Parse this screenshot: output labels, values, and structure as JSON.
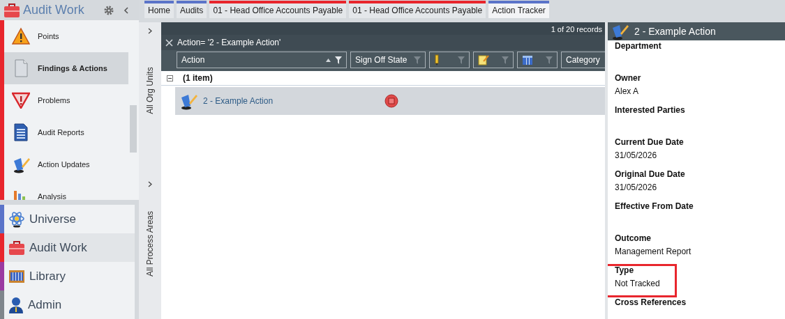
{
  "sidebar": {
    "title": "Audit Work",
    "items": [
      {
        "label": "Points",
        "selected": false
      },
      {
        "label": "Findings & Actions",
        "selected": true
      },
      {
        "label": "Problems",
        "selected": false
      },
      {
        "label": "Audit Reports",
        "selected": false
      },
      {
        "label": "Action Updates",
        "selected": false
      },
      {
        "label": "Analysis",
        "selected": false
      }
    ],
    "modules": [
      {
        "label": "Universe",
        "color": "#5b74c9",
        "selected": false
      },
      {
        "label": "Audit Work",
        "color": "#e8262d",
        "selected": true
      },
      {
        "label": "Library",
        "color": "#9b3aa1",
        "selected": false
      },
      {
        "label": "Admin",
        "color": "#7f868c",
        "selected": false
      }
    ]
  },
  "tabs": [
    {
      "label": "Home",
      "color": "#5b74c9",
      "selected": false
    },
    {
      "label": "Audits",
      "color": "#5b74c9",
      "selected": false
    },
    {
      "label": "01 - Head Office Accounts Payable",
      "color": "#e8262d",
      "selected": false
    },
    {
      "label": "01 - Head Office Accounts Payable",
      "color": "#e8262d",
      "selected": false
    },
    {
      "label": "Action Tracker",
      "color": "#5b74c9",
      "selected": true
    }
  ],
  "side_strip": [
    "All Org Units",
    "All Process Areas"
  ],
  "grid": {
    "record_count": "1 of 20 records",
    "filter": "Action= '2 - Example Action'",
    "columns": [
      {
        "kind": "text",
        "label": "Action",
        "sorted": true
      },
      {
        "kind": "text",
        "label": "Sign Off State",
        "sorted": false
      },
      {
        "kind": "icon",
        "sorted": false
      },
      {
        "kind": "icon",
        "sorted": false
      },
      {
        "kind": "icon",
        "sorted": false
      },
      {
        "kind": "text",
        "label": "Category"
      }
    ],
    "group": {
      "label": "(1 item)",
      "expanded": true
    },
    "rows": [
      {
        "action": "2 - Example Action",
        "selected": true
      }
    ]
  },
  "detail": {
    "title": "2 - Example Action",
    "fields": [
      {
        "label": "Department",
        "highlighted": false
      },
      {
        "label": "Owner",
        "value": "Alex A",
        "highlighted": false
      },
      {
        "label": "Interested Parties",
        "highlighted": false
      },
      {
        "label": "Current Due Date",
        "value": "31/05/2026",
        "highlighted": false
      },
      {
        "label": "Original Due Date",
        "value": "31/05/2026",
        "highlighted": false
      },
      {
        "label": "Effective From Date",
        "highlighted": false
      },
      {
        "label": "Outcome",
        "value": "Management Report",
        "highlighted": false
      },
      {
        "label": "Type",
        "value": "Not Tracked",
        "highlighted": true
      },
      {
        "label": "Cross References",
        "highlighted": false
      }
    ]
  }
}
